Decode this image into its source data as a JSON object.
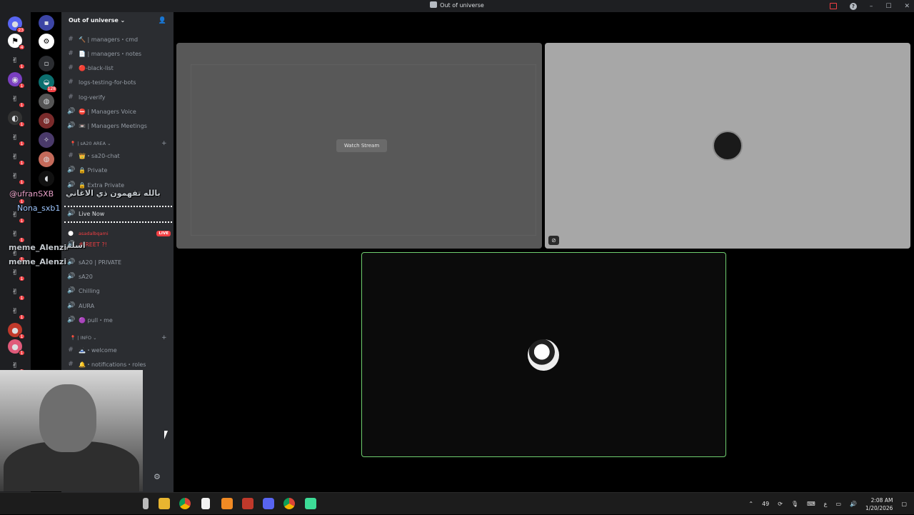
{
  "window": {
    "title": "Out of universe"
  },
  "server": {
    "name": "Out of universe ⌄"
  },
  "server_badges": [
    "23",
    "4",
    "1",
    "1",
    "1",
    "1",
    "1",
    "1",
    "1",
    "1",
    "1",
    "1",
    "1",
    "1",
    "1",
    "1",
    "1",
    "1",
    "1"
  ],
  "folder_badges": {
    "teal": "128"
  },
  "channels": [
    {
      "icon": "#",
      "label": "🔨 | managers・cmd"
    },
    {
      "icon": "#",
      "label": "📄 | managers・notes"
    },
    {
      "icon": "#",
      "label": "🔴-black-list"
    },
    {
      "icon": "#",
      "label": "logs-testing-for-bots"
    },
    {
      "icon": "#",
      "label": "log-verify"
    },
    {
      "icon": "🔊",
      "label": "⛔ | Managers Voice"
    },
    {
      "icon": "🔊",
      "label": "📼 | Managers Meetings"
    }
  ],
  "category_area": "📍 | sA20 AREA ⌄",
  "area_channels": [
    {
      "icon": "#",
      "label": "👑・sa20-chat"
    },
    {
      "icon": "🔊",
      "label": "🔒 Private"
    },
    {
      "icon": "🔊",
      "label": "🔒 Extra Private"
    }
  ],
  "live_now": "Live Now",
  "live_user": "asadalbqami",
  "live_badge": "LIVE",
  "reet": "# REET ?!",
  "private_channels": [
    {
      "icon": "🔊",
      "label": "sA20 | PRIVATE"
    },
    {
      "icon": "🔊",
      "label": "sA20"
    },
    {
      "icon": "🔊",
      "label": "Chilling"
    },
    {
      "icon": "🔊",
      "label": "AURA"
    },
    {
      "icon": "🔊",
      "label": "🟣 pull・me"
    }
  ],
  "category_info": "📍 | INFO ⌄",
  "info_channels": [
    {
      "icon": "#",
      "label": "🗻・welcome"
    },
    {
      "icon": "#",
      "label": "🔔・notifications・roles"
    }
  ],
  "overlay": {
    "arabic1": "بالله تفهمون ذي الاغاني",
    "name1": "@ufranSXB",
    "name2": "Nona_sxb1",
    "arabic2": "اسلم",
    "name3": "meme_Alenzi",
    "name4": "meme_Alenzi"
  },
  "stage": {
    "watch_button": "Watch Stream"
  },
  "taskbar": {
    "tray_count": "49",
    "lang": "ع",
    "time": "2:08 AM",
    "date": "1/20/2026"
  },
  "colors": {
    "live": "#f23f43",
    "speaking": "#6fcf6f",
    "badge": "#f23f43"
  }
}
